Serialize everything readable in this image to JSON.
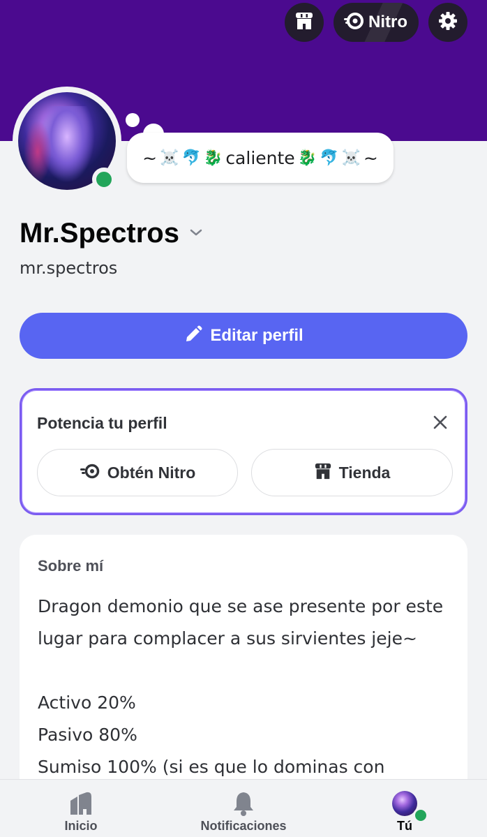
{
  "header": {
    "nitro_label": "Nitro"
  },
  "profile": {
    "status_text": "caliente",
    "status_emoji_left": [
      "☠️",
      "🐬",
      "🐉"
    ],
    "status_emoji_right": [
      "🐉",
      "🐬",
      "☠️"
    ],
    "status_prefix": "~",
    "status_suffix": "~",
    "display_name": "Mr.Spectros",
    "username": "mr.spectros",
    "online_color": "#23a55a"
  },
  "actions": {
    "edit_profile_label": "Editar perfil",
    "accent_color": "#5865f2"
  },
  "boost": {
    "title": "Potencia tu perfil",
    "nitro_label": "Obtén Nitro",
    "shop_label": "Tienda"
  },
  "about": {
    "title": "Sobre mí",
    "body": "Dragon demonio que se ase presente por este lugar para complacer a sus sirvientes jeje~\n\nActivo 20%\nPasivo 80%\nSumiso 100% (si es que lo dominas con"
  },
  "nav": {
    "home_label": "Inicio",
    "notifications_label": "Notificaciones",
    "you_label": "Tú"
  },
  "colors": {
    "banner": "#4b0a8f",
    "boost_border": "#7b5cf0"
  }
}
